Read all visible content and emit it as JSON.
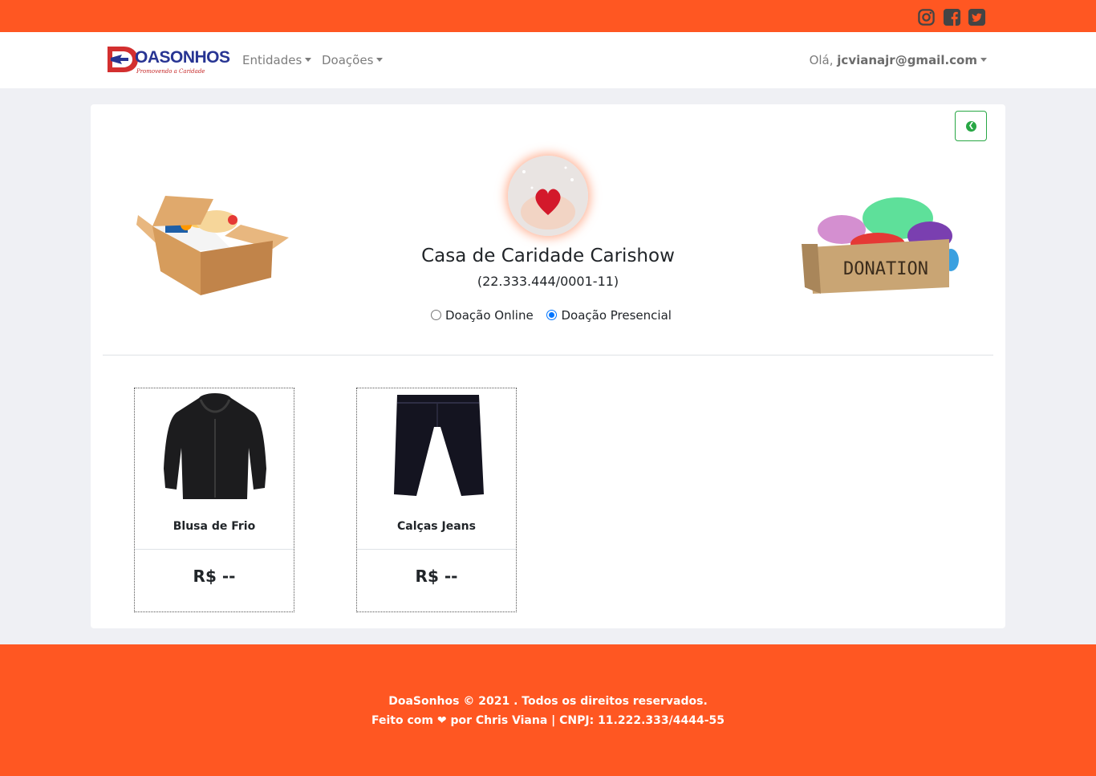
{
  "topbar": {
    "social": [
      {
        "icon": "instagram-icon"
      },
      {
        "icon": "facebook-icon"
      },
      {
        "icon": "twitter-icon"
      }
    ],
    "color": "#ff5722"
  },
  "navbar": {
    "logo_text": "OASONHOS",
    "logo_tagline": "Promovendo a Caridade",
    "menu": [
      {
        "label": "Entidades"
      },
      {
        "label": "Doações"
      }
    ],
    "user_greeting": "Olá,",
    "user_email": "jcvianajr@gmail.com"
  },
  "entity": {
    "name": "Casa de Caridade Carishow",
    "cnpj": "(22.333.444/0001-11)",
    "donation_types": [
      {
        "label": "Doação Online",
        "checked": false
      },
      {
        "label": "Doação Presencial",
        "checked": true
      }
    ],
    "donation_image_text": "DONATION"
  },
  "products": [
    {
      "name": "Blusa de Frio",
      "price": "R$ --"
    },
    {
      "name": "Calças Jeans",
      "price": "R$ --"
    }
  ],
  "footer": {
    "line1": "DoaSonhos © 2021 . Todos os direitos reservados.",
    "line2_prefix": "Feito com",
    "line2_suffix": "por Chris Viana | CNPJ: 11.222.333/4444-55"
  },
  "colors": {
    "accent": "#ff5722",
    "success": "#28a745",
    "radio": "#0075ff"
  }
}
